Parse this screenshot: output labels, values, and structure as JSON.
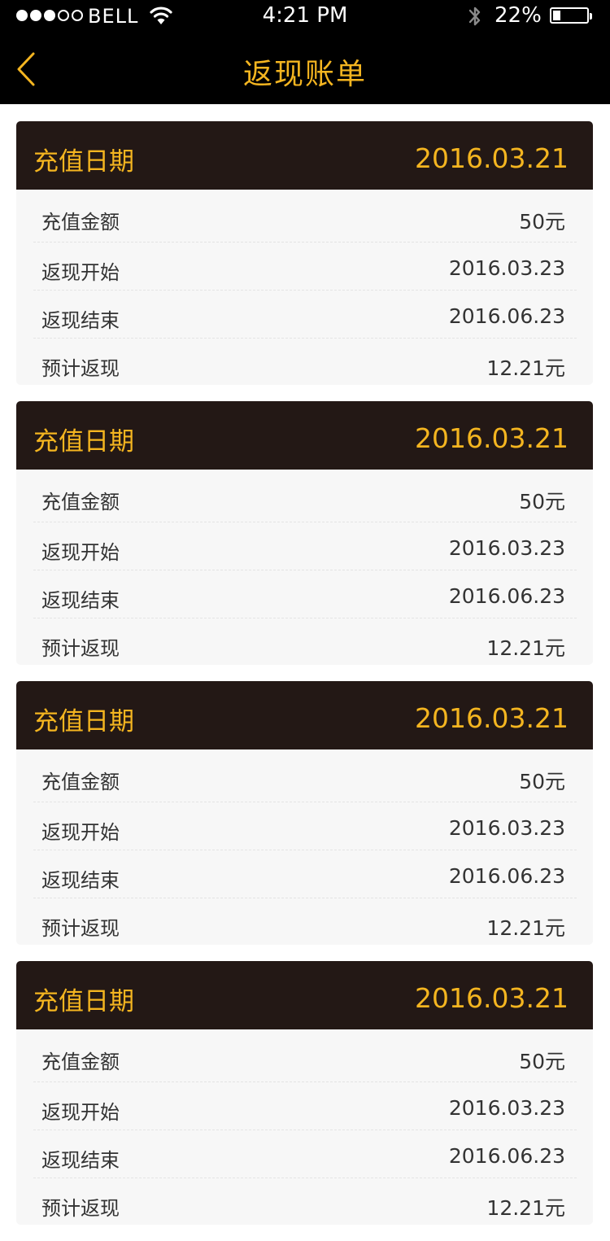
{
  "status_bar": {
    "carrier": "BELL",
    "time": "4:21 PM",
    "battery_percent": "22%",
    "battery_level": 0.22,
    "signal_bars": 3,
    "signal_total": 5,
    "icons": [
      "wifi-icon",
      "bluetooth-icon",
      "battery-icon"
    ]
  },
  "nav": {
    "title": "返现账单",
    "back_icon": "chevron-left-icon"
  },
  "colors": {
    "accent": "#f4b520",
    "card_header": "#231815",
    "card_body": "#f7f7f7",
    "text": "#333333"
  },
  "cards": [
    {
      "header_label": "充值日期",
      "header_date": "2016.03.21",
      "rows": [
        {
          "label": "充值金额",
          "value": "50元"
        },
        {
          "label": "返现开始",
          "value": "2016.03.23"
        },
        {
          "label": "返现结束",
          "value": "2016.06.23"
        },
        {
          "label": "预计返现",
          "value": "12.21元"
        }
      ]
    },
    {
      "header_label": "充值日期",
      "header_date": "2016.03.21",
      "rows": [
        {
          "label": "充值金额",
          "value": "50元"
        },
        {
          "label": "返现开始",
          "value": "2016.03.23"
        },
        {
          "label": "返现结束",
          "value": "2016.06.23"
        },
        {
          "label": "预计返现",
          "value": "12.21元"
        }
      ]
    },
    {
      "header_label": "充值日期",
      "header_date": "2016.03.21",
      "rows": [
        {
          "label": "充值金额",
          "value": "50元"
        },
        {
          "label": "返现开始",
          "value": "2016.03.23"
        },
        {
          "label": "返现结束",
          "value": "2016.06.23"
        },
        {
          "label": "预计返现",
          "value": "12.21元"
        }
      ]
    },
    {
      "header_label": "充值日期",
      "header_date": "2016.03.21",
      "rows": [
        {
          "label": "充值金额",
          "value": "50元"
        },
        {
          "label": "返现开始",
          "value": "2016.03.23"
        },
        {
          "label": "返现结束",
          "value": "2016.06.23"
        },
        {
          "label": "预计返现",
          "value": "12.21元"
        }
      ]
    }
  ]
}
